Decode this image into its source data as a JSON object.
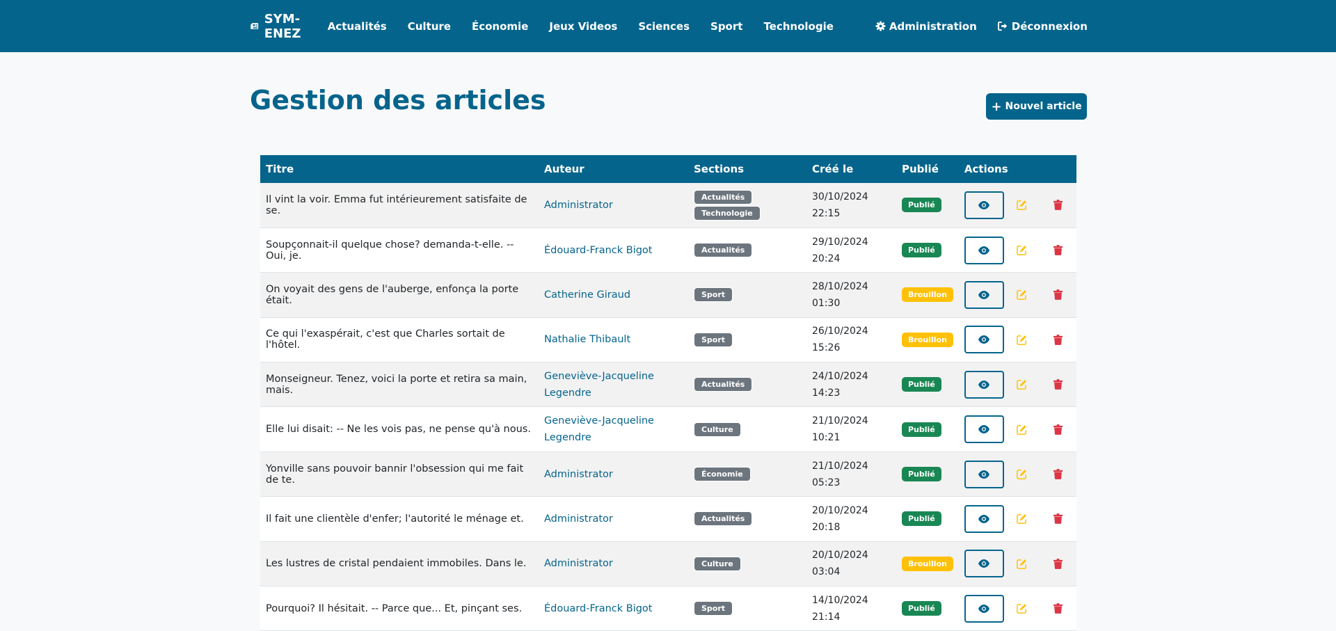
{
  "navbar": {
    "brand": "SYM-ENEZ",
    "links": [
      "Actualités",
      "Culture",
      "Économie",
      "Jeux Videos",
      "Sciences",
      "Sport",
      "Technologie"
    ],
    "admin": "Administration",
    "logout": "Déconnexion"
  },
  "page": {
    "title": "Gestion des articles",
    "new_button": "Nouvel article"
  },
  "table": {
    "headers": [
      "Titre",
      "Auteur",
      "Sections",
      "Créé le",
      "Publié",
      "Actions"
    ],
    "rows": [
      {
        "title": "Il vint la voir. Emma fut intérieurement satisfaite de se.",
        "author": "Administrator",
        "sections": [
          "Actualités",
          "Technologie"
        ],
        "date": "30/10/2024",
        "time": "22:15",
        "status": "Publié"
      },
      {
        "title": "Soupçonnait-il quelque chose? demanda-t-elle. -- Oui, je.",
        "author": "Édouard-Franck Bigot",
        "sections": [
          "Actualités"
        ],
        "date": "29/10/2024",
        "time": "20:24",
        "status": "Publié"
      },
      {
        "title": "On voyait des gens de l'auberge, enfonça la porte était.",
        "author": "Catherine Giraud",
        "sections": [
          "Sport"
        ],
        "date": "28/10/2024",
        "time": "01:30",
        "status": "Brouillon"
      },
      {
        "title": "Ce qui l'exaspérait, c'est que Charles sortait de l'hôtel.",
        "author": "Nathalie Thibault",
        "sections": [
          "Sport"
        ],
        "date": "26/10/2024",
        "time": "15:26",
        "status": "Brouillon"
      },
      {
        "title": "Monseigneur. Tenez, voici la porte et retira sa main, mais.",
        "author": "Geneviève-Jacqueline Legendre",
        "sections": [
          "Actualités"
        ],
        "date": "24/10/2024",
        "time": "14:23",
        "status": "Publié"
      },
      {
        "title": "Elle lui disait: -- Ne les vois pas, ne pense qu'à nous.",
        "author": "Geneviève-Jacqueline Legendre",
        "sections": [
          "Culture"
        ],
        "date": "21/10/2024",
        "time": "10:21",
        "status": "Publié"
      },
      {
        "title": "Yonville sans pouvoir bannir l'obsession qui me fait de te.",
        "author": "Administrator",
        "sections": [
          "Économie"
        ],
        "date": "21/10/2024",
        "time": "05:23",
        "status": "Publié"
      },
      {
        "title": "Il fait une clientèle d'enfer; l'autorité le ménage et.",
        "author": "Administrator",
        "sections": [
          "Actualités"
        ],
        "date": "20/10/2024",
        "time": "20:18",
        "status": "Publié"
      },
      {
        "title": "Les lustres de cristal pendaient immobiles. Dans le.",
        "author": "Administrator",
        "sections": [
          "Culture"
        ],
        "date": "20/10/2024",
        "time": "03:04",
        "status": "Brouillon"
      },
      {
        "title": "Pourquoi? Il hésitait. -- Parce que... Et, pinçant ses.",
        "author": "Édouard-Franck Bigot",
        "sections": [
          "Sport"
        ],
        "date": "14/10/2024",
        "time": "21:14",
        "status": "Publié"
      }
    ]
  },
  "colors": {
    "primary": "#05648c",
    "published": "#198754",
    "draft": "#ffc107",
    "section": "#6c757d",
    "edit": "#ffc107",
    "delete": "#dc3545"
  },
  "icons": {
    "brand": "newspaper-icon",
    "admin": "gear-icon",
    "logout": "sign-out-icon",
    "new": "plus-icon",
    "view": "eye-icon",
    "edit": "edit-icon",
    "delete": "trash-icon"
  }
}
